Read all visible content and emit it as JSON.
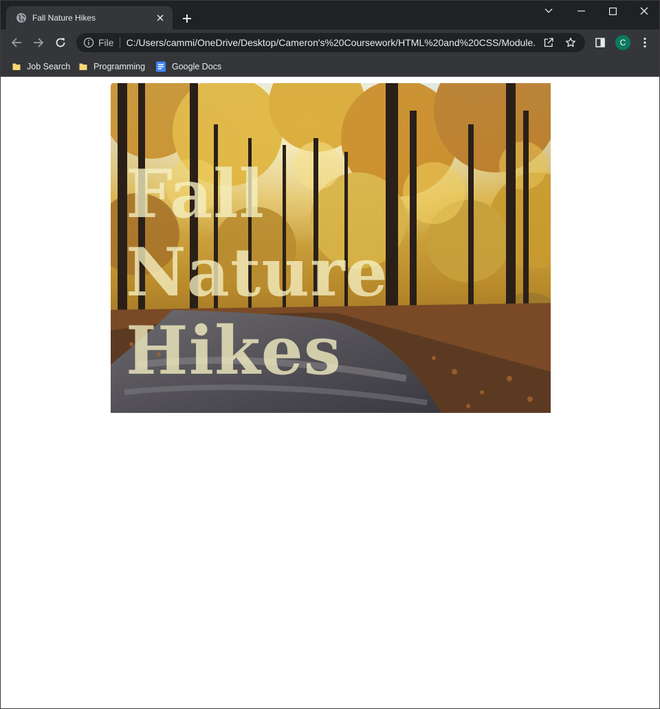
{
  "browser": {
    "tab": {
      "title": "Fall Nature Hikes",
      "icon": "globe-icon",
      "close_icon": "close-icon"
    },
    "new_tab_icon": "plus-icon",
    "window_controls": [
      "tab-search-icon",
      "minimize-icon",
      "maximize-icon",
      "close-icon"
    ],
    "toolbar": {
      "back_icon": "arrow-left-icon",
      "forward_icon": "arrow-right-icon",
      "reload_icon": "reload-icon",
      "scheme": "File",
      "url": "C:/Users/cammi/OneDrive/Desktop/Cameron's%20Coursework/HTML%20and%20CSS/Module...",
      "share_icon": "share-icon",
      "bookmark_star_icon": "star-icon",
      "side_panel_icon": "side-panel-icon",
      "profile_initial": "C",
      "menu_icon": "kebab-menu-icon"
    },
    "bookmarks": [
      {
        "label": "Job Search",
        "icon": "folder-icon"
      },
      {
        "label": "Programming",
        "icon": "folder-icon"
      },
      {
        "label": "Google Docs",
        "icon": "google-docs-icon"
      }
    ]
  },
  "page": {
    "hero_title": "Fall Nature Hikes",
    "hero_image": "autumn forest path photo"
  },
  "colors": {
    "chrome_dark": "#202124",
    "chrome_toolbar": "#35363a",
    "profile_avatar": "#0b7a5e",
    "hero_text": "#f5f0c3"
  }
}
